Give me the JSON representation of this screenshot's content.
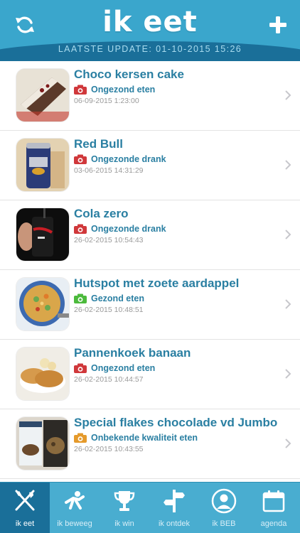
{
  "header": {
    "brand": "ik eet",
    "update": "LAATSTE UPDATE: 01-10-2015 15:26",
    "refresh_icon": "refresh-icon",
    "add_icon": "plus-icon"
  },
  "colors": {
    "unhealthy": "#d0383b",
    "healthy": "#4cba3c",
    "unknown": "#e59a2b",
    "title": "#2a7fa2"
  },
  "entries": [
    {
      "title": "Choco kersen cake",
      "status": "Ongezond eten",
      "quality": "unhealthy",
      "date": "06-09-2015 1:23:00"
    },
    {
      "title": "Red Bull",
      "status": "Ongezonde drank",
      "quality": "unhealthy",
      "date": "03-06-2015 14:31:29"
    },
    {
      "title": "Cola zero",
      "status": "Ongezonde drank",
      "quality": "unhealthy",
      "date": "26-02-2015 10:54:43"
    },
    {
      "title": "Hutspot met zoete aardappel",
      "status": "Gezond eten",
      "quality": "healthy",
      "date": "26-02-2015 10:48:51"
    },
    {
      "title": "Pannenkoek banaan",
      "status": "Ongezond eten",
      "quality": "unhealthy",
      "date": "26-02-2015 10:44:57"
    },
    {
      "title": "Special flakes chocolade vd Jumbo",
      "status": "Onbekende kwaliteit eten",
      "quality": "unknown",
      "date": "26-02-2015 10:43:55"
    }
  ],
  "tabs": [
    {
      "label": "ik eet",
      "icon": "fork-knife-icon"
    },
    {
      "label": "ik beweeg",
      "icon": "running-person-icon"
    },
    {
      "label": "ik win",
      "icon": "trophy-icon"
    },
    {
      "label": "ik ontdek",
      "icon": "signpost-icon"
    },
    {
      "label": "ik BEB",
      "icon": "profile-icon"
    },
    {
      "label": "agenda",
      "icon": "calendar-icon"
    }
  ]
}
